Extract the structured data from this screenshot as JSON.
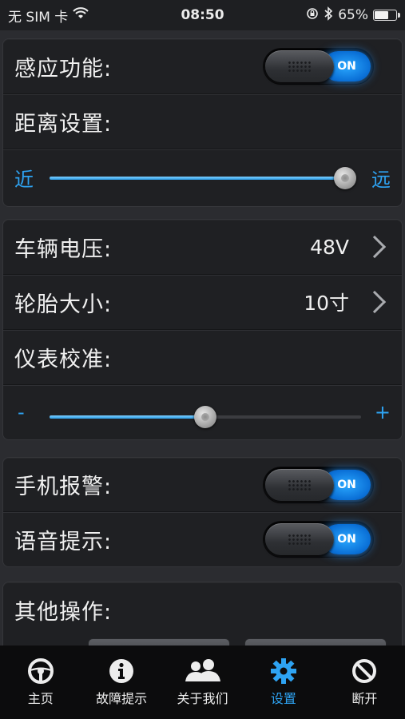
{
  "status": {
    "carrier": "无 SIM 卡",
    "time": "08:50",
    "battery": "65%",
    "battery_level": 0.65
  },
  "sensing": {
    "label": "感应功能:",
    "toggle": "ON"
  },
  "distance": {
    "label": "距离设置:",
    "near": "近",
    "far": "远",
    "level": 0.98
  },
  "voltage": {
    "label": "车辆电压:",
    "value": "48V"
  },
  "tire": {
    "label": "轮胎大小:",
    "value": "10寸"
  },
  "calibration": {
    "label": "仪表校准:",
    "minus": "-",
    "plus": "+",
    "level": 0.5
  },
  "phone_alarm": {
    "label": "手机报警:",
    "toggle": "ON"
  },
  "voice_prompt": {
    "label": "语音提示:",
    "toggle": "ON"
  },
  "other": {
    "label": "其他操作:"
  },
  "tabs": [
    {
      "label": "主页",
      "icon": "steering-wheel-icon"
    },
    {
      "label": "故障提示",
      "icon": "info-icon"
    },
    {
      "label": "关于我们",
      "icon": "users-icon"
    },
    {
      "label": "设置",
      "icon": "gear-icon",
      "active": true
    },
    {
      "label": "断开",
      "icon": "disconnect-icon"
    }
  ],
  "colors": {
    "accent": "#2ea3f2",
    "toggle_on": "#1a8cf0",
    "background": "#2b2c30"
  }
}
